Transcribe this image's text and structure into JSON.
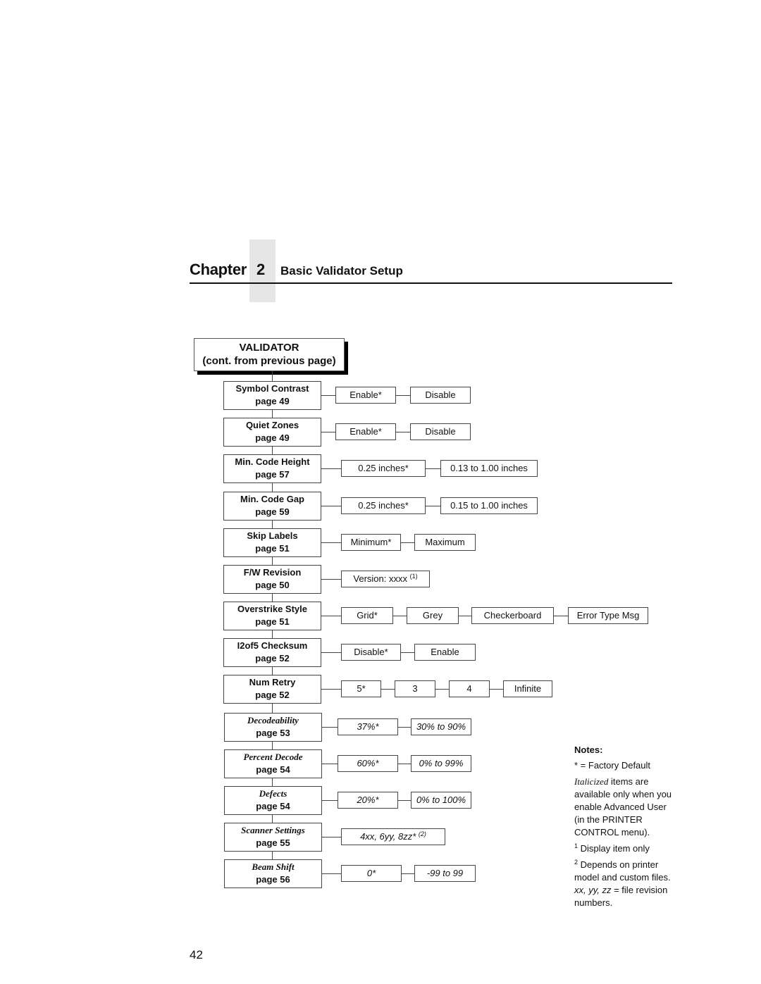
{
  "header": {
    "chapter_word": "Chapter",
    "chapter_number": "2",
    "chapter_title": "Basic Validator Setup"
  },
  "root": {
    "title": "VALIDATOR",
    "subtitle": "(cont. from previous page)"
  },
  "menu_items": [
    {
      "name": "Symbol Contrast",
      "page": "page 49",
      "advanced": false,
      "options": [
        "Enable*",
        "Disable"
      ]
    },
    {
      "name": "Quiet Zones",
      "page": "page 49",
      "advanced": false,
      "options": [
        "Enable*",
        "Disable"
      ]
    },
    {
      "name": "Min. Code Height",
      "page": "page 57",
      "advanced": false,
      "options": [
        "0.25 inches*",
        "0.13 to 1.00 inches"
      ]
    },
    {
      "name": "Min. Code Gap",
      "page": "page 59",
      "advanced": false,
      "options": [
        "0.25 inches*",
        "0.15 to 1.00 inches"
      ]
    },
    {
      "name": "Skip Labels",
      "page": "page 51",
      "advanced": false,
      "options": [
        "Minimum*",
        "Maximum"
      ]
    },
    {
      "name": "F/W Revision",
      "page": "page 50",
      "advanced": false,
      "options": [
        "Version: xxxx"
      ],
      "option_footnote": "(1)"
    },
    {
      "name": "Overstrike Style",
      "page": "page 51",
      "advanced": false,
      "options": [
        "Grid*",
        "Grey",
        "Checkerboard",
        "Error Type Msg"
      ]
    },
    {
      "name": "I2of5 Checksum",
      "page": "page 52",
      "advanced": false,
      "options": [
        "Disable*",
        "Enable"
      ]
    },
    {
      "name": "Num Retry",
      "page": "page 52",
      "advanced": false,
      "options": [
        "5*",
        "3",
        "4",
        "Infinite"
      ]
    },
    {
      "name": "Decodeability",
      "page": "page 53",
      "advanced": true,
      "options": [
        "37%*",
        "30% to 90%"
      ]
    },
    {
      "name": "Percent Decode",
      "page": "page 54",
      "advanced": true,
      "options": [
        "60%*",
        "0% to 99%"
      ]
    },
    {
      "name": "Defects",
      "page": "page 54",
      "advanced": true,
      "options": [
        "20%*",
        "0% to 100%"
      ]
    },
    {
      "name": "Scanner Settings",
      "page": "page 55",
      "advanced": true,
      "options": [
        "4xx, 6yy, 8zz*"
      ],
      "option_footnote": "(2)"
    },
    {
      "name": "Beam Shift",
      "page": "page 56",
      "advanced": true,
      "options": [
        "0*",
        "-99 to 99"
      ]
    }
  ],
  "notes": {
    "title": "Notes:",
    "factory_default": "* = Factory Default",
    "italic_word": "Italicized",
    "italic_rest": " items are available only when you enable Advanced User (in the PRINTER CONTROL menu).",
    "fn1_mark": "1",
    "fn1_text": " Display item only",
    "fn2_mark": "2",
    "fn2_text_a": " Depends on printer model and custom files. ",
    "fn2_vars": "xx, yy, zz",
    "fn2_text_b": " = file revision numbers."
  },
  "page_number": "42"
}
